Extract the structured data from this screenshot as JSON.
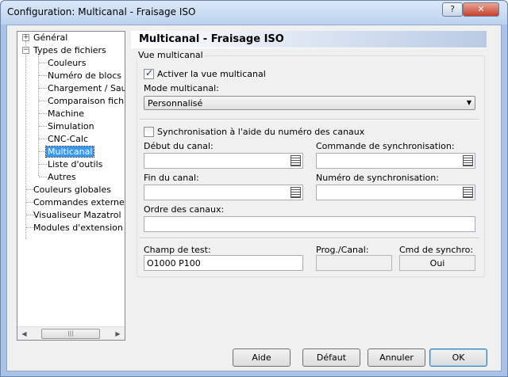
{
  "window": {
    "title": "Configuration: Multicanal - Fraisage ISO",
    "help_label": "?",
    "close_label": "✕"
  },
  "tree": {
    "items": [
      {
        "label": "Général",
        "expander": "+"
      },
      {
        "label": "Types de fichiers",
        "expander": "−"
      },
      {
        "label": "Couleurs"
      },
      {
        "label": "Numéro de blocs"
      },
      {
        "label": "Chargement / Sau"
      },
      {
        "label": "Comparaison fichie"
      },
      {
        "label": "Machine"
      },
      {
        "label": "Simulation"
      },
      {
        "label": "CNC-Calc"
      },
      {
        "label": "Multicanal",
        "selected": true
      },
      {
        "label": "Liste d'outils"
      },
      {
        "label": "Autres"
      },
      {
        "label": "Couleurs globales"
      },
      {
        "label": "Commandes externes"
      },
      {
        "label": "Visualiseur Mazatrol"
      },
      {
        "label": "Modules d'extension"
      }
    ],
    "scroll_left": "◀",
    "scroll_right": "▶",
    "thumb_grip": "|||"
  },
  "panel": {
    "title": "Multicanal - Fraisage ISO",
    "group_label": "Vue multicanal",
    "activate_label": "Activer la vue multicanal",
    "activate_checked": true,
    "mode_label": "Mode multicanal:",
    "mode_value": "Personnalisé",
    "sync_label": "Synchronisation à l'aide du numéro des canaux",
    "sync_checked": false,
    "debut_label": "Début du canal:",
    "debut_value": "",
    "commande_label": "Commande de synchronisation:",
    "commande_value": "",
    "fin_label": "Fin du canal:",
    "fin_value": "",
    "numero_label": "Numéro de synchronisation:",
    "numero_value": "",
    "ordre_label": "Ordre des canaux:",
    "ordre_value": "",
    "champ_label": "Champ de test:",
    "champ_value": "O1000 P100",
    "prog_label": "Prog./Canal:",
    "prog_value": "",
    "cmd_label": "Cmd de synchro:",
    "cmd_value": "Oui"
  },
  "buttons": {
    "aide": "Aide",
    "defaut": "Défaut",
    "annuler": "Annuler",
    "ok": "OK"
  }
}
